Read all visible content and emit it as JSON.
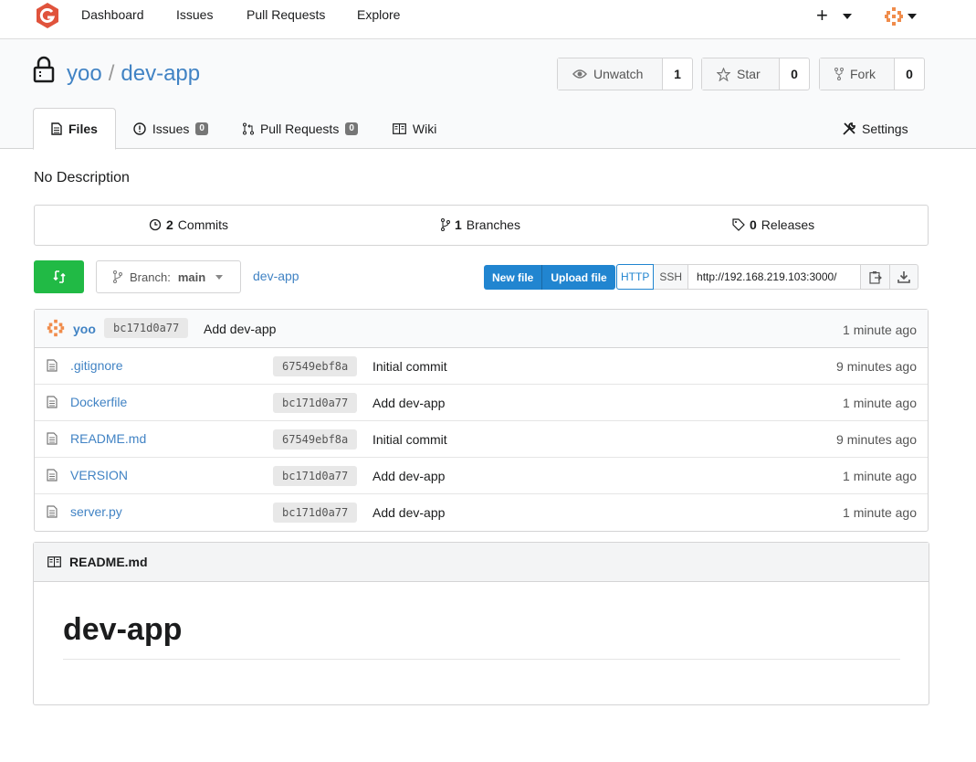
{
  "nav": {
    "links": [
      "Dashboard",
      "Issues",
      "Pull Requests",
      "Explore"
    ],
    "plus": "+"
  },
  "repo": {
    "owner": "yoo",
    "name": "dev-app",
    "separator": "/",
    "watch": {
      "label": "Unwatch",
      "count": "1"
    },
    "star": {
      "label": "Star",
      "count": "0"
    },
    "fork": {
      "label": "Fork",
      "count": "0"
    }
  },
  "tabs": {
    "files": "Files",
    "issues": "Issues",
    "issues_count": "0",
    "pulls": "Pull Requests",
    "pulls_count": "0",
    "wiki": "Wiki",
    "settings": "Settings"
  },
  "description": "No Description",
  "stats": {
    "commits_count": "2",
    "commits_label": "Commits",
    "branches_count": "1",
    "branches_label": "Branches",
    "releases_count": "0",
    "releases_label": "Releases"
  },
  "branch": {
    "prefix": "Branch:",
    "name": "main",
    "crumb": "dev-app"
  },
  "actions": {
    "new_file": "New file",
    "upload_file": "Upload file",
    "http": "HTTP",
    "ssh": "SSH",
    "clone_url": "http://192.168.219.103:3000/"
  },
  "latest_commit": {
    "author": "yoo",
    "sha": "bc171d0a77",
    "message": "Add dev-app",
    "time": "1 minute ago"
  },
  "files": [
    {
      "name": ".gitignore",
      "sha": "67549ebf8a",
      "message": "Initial commit",
      "time": "9 minutes ago"
    },
    {
      "name": "Dockerfile",
      "sha": "bc171d0a77",
      "message": "Add dev-app",
      "time": "1 minute ago"
    },
    {
      "name": "README.md",
      "sha": "67549ebf8a",
      "message": "Initial commit",
      "time": "9 minutes ago"
    },
    {
      "name": "VERSION",
      "sha": "bc171d0a77",
      "message": "Add dev-app",
      "time": "1 minute ago"
    },
    {
      "name": "server.py",
      "sha": "bc171d0a77",
      "message": "Add dev-app",
      "time": "1 minute ago"
    }
  ],
  "readme": {
    "filename": "README.md",
    "heading": "dev-app"
  },
  "colors": {
    "link": "#4183c4",
    "primary": "#2185d0",
    "green": "#21ba45",
    "logo": "#e0533c"
  }
}
